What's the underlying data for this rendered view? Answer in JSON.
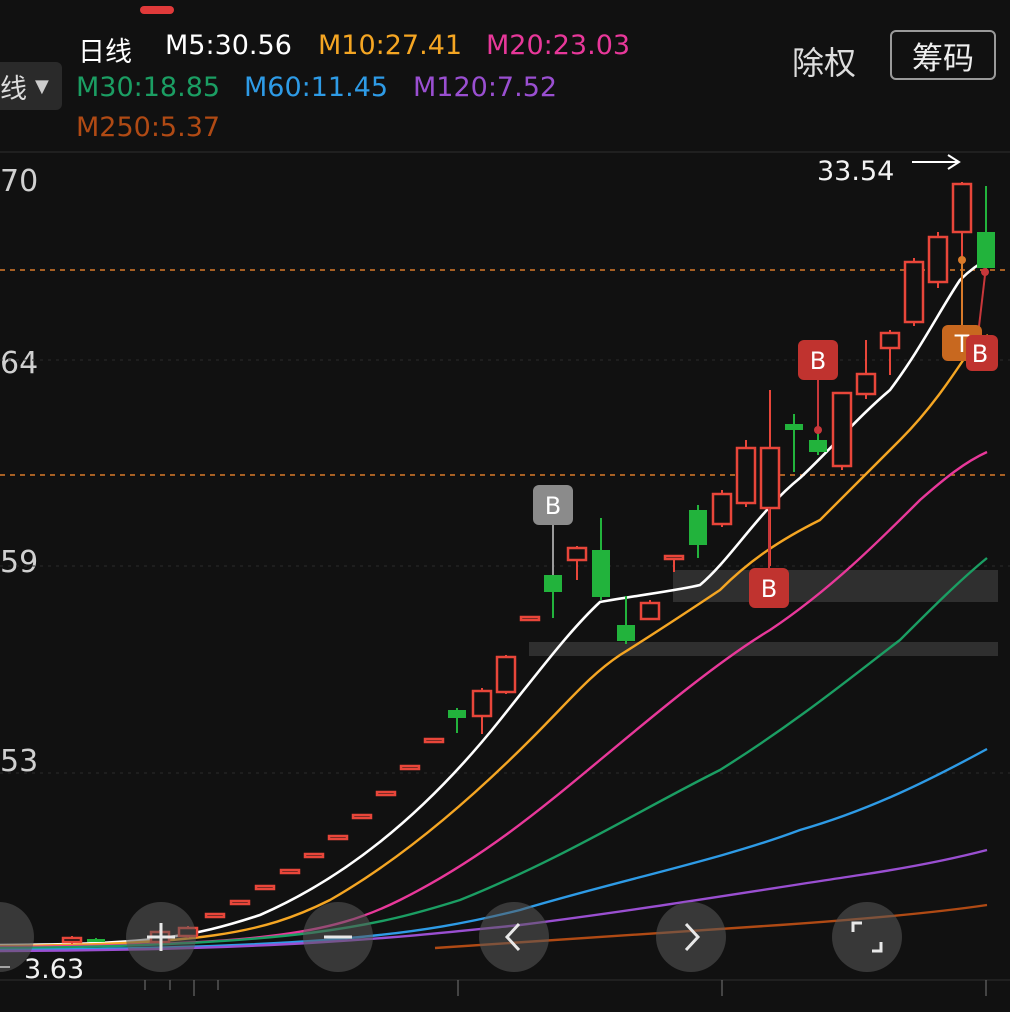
{
  "header": {
    "period_label": "日线",
    "period_dropdown_label": "线",
    "ex_rights_button": "除权",
    "chips_button": "筹码"
  },
  "moving_averages": [
    {
      "name": "M5",
      "value": "M5:30.56",
      "color": "#ffffff"
    },
    {
      "name": "M10",
      "value": "M10:27.41",
      "color": "#f5a623"
    },
    {
      "name": "M20",
      "value": "M20:23.03",
      "color": "#e8389a"
    },
    {
      "name": "M30",
      "value": "M30:18.85",
      "color": "#1b9e63"
    },
    {
      "name": "M60",
      "value": "M60:11.45",
      "color": "#2e9be6"
    },
    {
      "name": "M120",
      "value": "M120:7.52",
      "color": "#9a4fd1"
    },
    {
      "name": "M250",
      "value": "M250:5.37",
      "color": "#b04a14"
    }
  ],
  "y_axis_labels": [
    "70",
    "64",
    "59",
    "53"
  ],
  "price_labels": {
    "high": "33.54",
    "low": "3.63"
  },
  "markers": [
    "B",
    "B",
    "B",
    "T",
    "B"
  ],
  "controls": [
    "zoom-in",
    "zoom-out",
    "scroll-left",
    "scroll-right",
    "fullscreen"
  ],
  "colors": {
    "up": "#e8463a",
    "down": "#22b33c",
    "background": "#111111",
    "dashed_line": "#d97a2a"
  }
}
